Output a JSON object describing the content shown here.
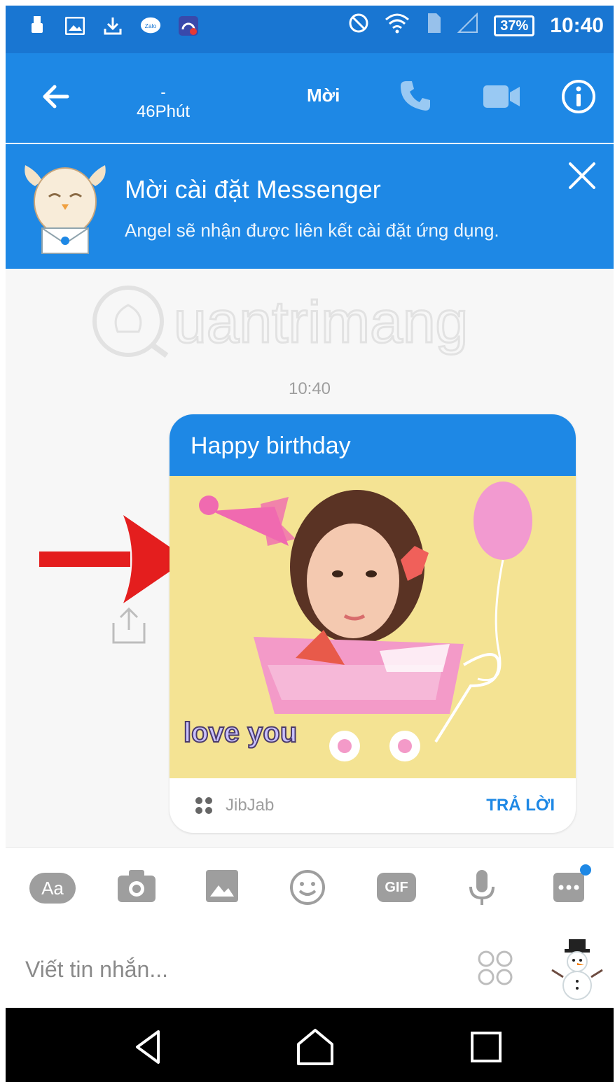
{
  "status_bar": {
    "battery": "37%",
    "time": "10:40"
  },
  "header": {
    "title_dash": "-",
    "subtitle": "46Phút",
    "invite_label": "Mời"
  },
  "banner": {
    "title": "Mời cài đặt Messenger",
    "subtitle": "Angel sẽ nhận được liên kết cài đặt ứng dụng."
  },
  "chat": {
    "timestamp": "10:40",
    "card": {
      "title": "Happy birthday",
      "image_caption": "love you",
      "source": "JibJab",
      "reply_label": "TRẢ LỜI"
    }
  },
  "toolbar": {
    "text_button": "Aa",
    "gif_button": "GIF"
  },
  "composer": {
    "placeholder": "Viết tin nhắn..."
  },
  "watermark": "uantrimang",
  "colors": {
    "primary": "#1e88e5",
    "status_bar": "#1976d2",
    "card_image_bg": "#f4e393",
    "arrow": "#e41e1e"
  }
}
